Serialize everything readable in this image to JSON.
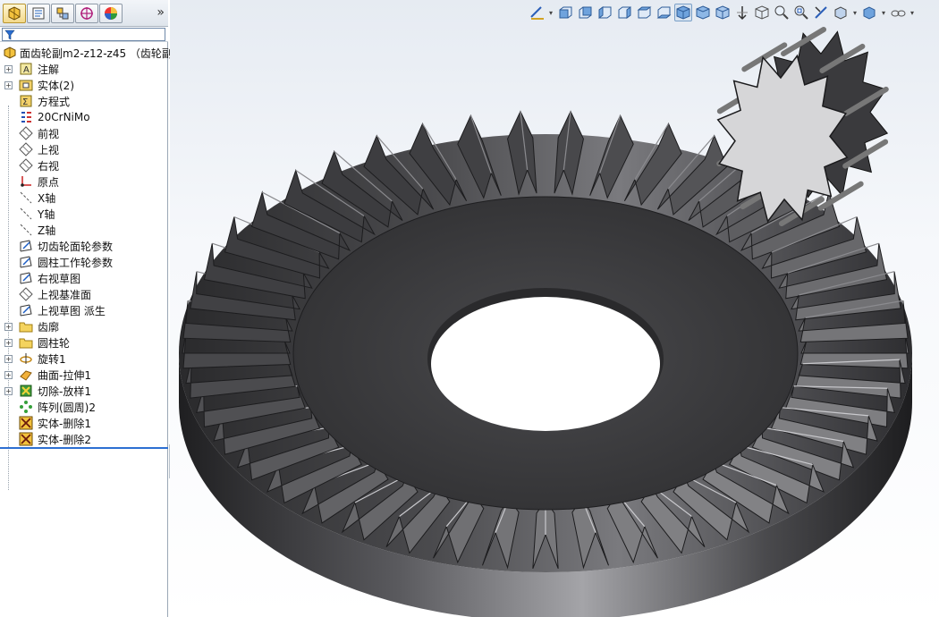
{
  "left_panel": {
    "tabs": [
      {
        "name": "feature-manager-tab",
        "icon": "feature-tree-icon"
      },
      {
        "name": "property-manager-tab",
        "icon": "property-icon"
      },
      {
        "name": "configuration-manager-tab",
        "icon": "configuration-icon"
      },
      {
        "name": "dimxpert-tab",
        "icon": "target-icon"
      },
      {
        "name": "display-manager-tab",
        "icon": "color-wheel-icon"
      }
    ],
    "more": "»",
    "filter_icon": "filter-icon",
    "tree_root": "面齿轮副m2-z12-z45 （齿轮副",
    "tree_items": [
      {
        "label": "注解",
        "icon": "annotation-icon",
        "expander": "+"
      },
      {
        "label": "实体(2)",
        "icon": "solid-bodies-icon",
        "expander": "+"
      },
      {
        "label": "方程式",
        "icon": "equation-icon",
        "expander": ""
      },
      {
        "label": "20CrNiMo",
        "icon": "material-icon",
        "expander": ""
      },
      {
        "label": "前视",
        "icon": "plane-icon",
        "expander": ""
      },
      {
        "label": "上视",
        "icon": "plane-icon",
        "expander": ""
      },
      {
        "label": "右视",
        "icon": "plane-icon",
        "expander": ""
      },
      {
        "label": "原点",
        "icon": "origin-icon",
        "expander": ""
      },
      {
        "label": "X轴",
        "icon": "axis-icon",
        "expander": ""
      },
      {
        "label": "Y轴",
        "icon": "axis-icon",
        "expander": ""
      },
      {
        "label": "Z轴",
        "icon": "axis-icon",
        "expander": ""
      },
      {
        "label": "切齿轮面轮参数",
        "icon": "sketch-icon",
        "expander": ""
      },
      {
        "label": "圆柱工作轮参数",
        "icon": "sketch-icon",
        "expander": ""
      },
      {
        "label": "右视草图",
        "icon": "sketch-icon",
        "expander": ""
      },
      {
        "label": "上视基准面",
        "icon": "plane-icon",
        "expander": ""
      },
      {
        "label": "上视草图 派生",
        "icon": "sketch-icon",
        "expander": ""
      },
      {
        "label": "齿廓",
        "icon": "folder-icon",
        "expander": "+"
      },
      {
        "label": "圆柱轮",
        "icon": "folder-icon",
        "expander": "+"
      },
      {
        "label": "旋转1",
        "icon": "revolve-icon",
        "expander": "+"
      },
      {
        "label": "曲面-拉伸1",
        "icon": "surface-extrude-icon",
        "expander": "+"
      },
      {
        "label": "切除-放样1",
        "icon": "cut-loft-icon",
        "expander": "+"
      },
      {
        "label": "阵列(圆周)2",
        "icon": "circular-pattern-icon",
        "expander": ""
      },
      {
        "label": "实体-删除1",
        "icon": "delete-body-icon",
        "expander": ""
      },
      {
        "label": "实体-删除2",
        "icon": "delete-body-icon",
        "expander": ""
      }
    ]
  },
  "view_toolbar": [
    {
      "name": "sketch-dropdown-icon"
    },
    {
      "name": "view-front-icon"
    },
    {
      "name": "view-back-icon"
    },
    {
      "name": "view-left-icon"
    },
    {
      "name": "view-right-icon"
    },
    {
      "name": "view-top-icon"
    },
    {
      "name": "view-bottom-icon"
    },
    {
      "name": "view-isometric-icon"
    },
    {
      "name": "view-trimetric-icon"
    },
    {
      "name": "view-dimetric-icon"
    },
    {
      "name": "normal-to-icon"
    },
    {
      "name": "shaded-icon"
    },
    {
      "name": "zoom-to-fit-icon"
    },
    {
      "name": "zoom-area-icon"
    },
    {
      "name": "section-view-icon"
    },
    {
      "name": "view-orientation-icon"
    },
    {
      "name": "display-style-icon"
    },
    {
      "name": "hide-show-icon"
    }
  ],
  "colors": {
    "gear_dark": "#3a3a3c",
    "gear_light": "#9a9a9e",
    "panel_border": "#9aa7b5",
    "selection_blue": "#2d6fd2"
  }
}
